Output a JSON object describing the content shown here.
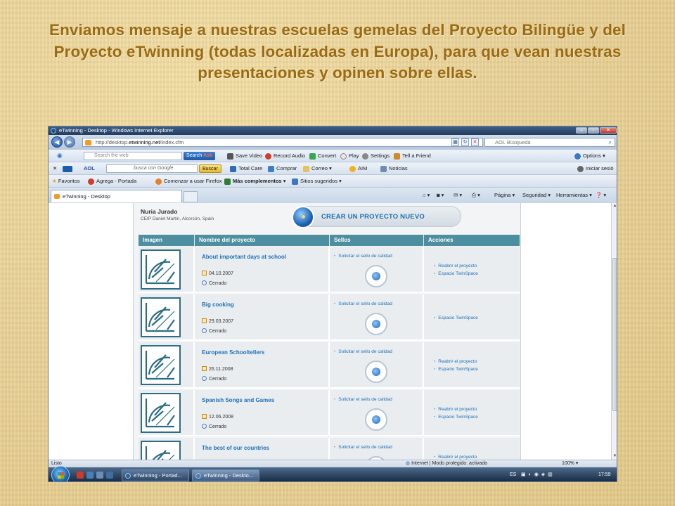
{
  "slide": {
    "title": "Enviamos mensaje a nuestras escuelas gemelas del Proyecto Bilingüe y del Proyecto eTwinning  (todas localizadas en Europa), para que vean nuestras presentaciones y opinen sobre ellas."
  },
  "browser": {
    "window_title": "eTwinning - Desktop - Windows Internet Explorer",
    "address_prefix": "http://desktop.",
    "address_domain": "etwinning.net",
    "address_suffix": "/index.cfm",
    "search_placeholder": "AOL Búsqueda",
    "ask_toolbar": {
      "search_placeholder": "Search the web",
      "search_button": "Search",
      "items": [
        "Save Video",
        "Record Audio",
        "Convert",
        "Play",
        "Settings",
        "Tell a Friend"
      ],
      "options": "Options"
    },
    "aol_toolbar": {
      "aol_label": "AOL",
      "google_placeholder": "busca con Google",
      "buscar_button": "Buscar",
      "items": [
        "Total Care",
        "Comprar",
        "Correo",
        "AIM",
        "Noticias"
      ],
      "login": "Iniciar sesió"
    },
    "favorites_bar": {
      "favorites": "Favoritos",
      "items": [
        "Agrega - Portada",
        "Comenzar a usar Firefox",
        "Más complementos",
        "Sitios sugeridos"
      ]
    },
    "tab_label": "eTwinning - Desktop",
    "command_bar": [
      "Página",
      "Seguridad",
      "Herramientas"
    ],
    "status_left": "Listo",
    "status_zone": "Internet | Modo protegido: activado",
    "zoom": "100%"
  },
  "page": {
    "user_name": "Nuria Jurado",
    "user_school": "CEIP Daniel Martín, Alcorcón, Spain",
    "create_button": "CREAR UN PROYECTO NUEVO",
    "table_headers": [
      "Imagen",
      "Nombre del proyecto",
      "Sellos",
      "Acciones"
    ],
    "projects": [
      {
        "name": "About important days at school",
        "date": "04.10.2007",
        "status": "Cerrado",
        "sello": "Solicitar el sello de calidad",
        "actions": [
          "Reabrir el proyecto",
          "Espacio TwinSpace"
        ]
      },
      {
        "name": "Big cooking",
        "date": "29.03.2007",
        "status": "Cerrado",
        "sello": "Solicitar el sello de calidad",
        "actions": [
          "Espacio TwinSpace"
        ]
      },
      {
        "name": "European Schooltellers",
        "date": "26.11.2008",
        "status": "Cerrado",
        "sello": "Solicitar el sello de calidad",
        "actions": [
          "Reabrir el proyecto",
          "Espacio TwinSpace"
        ]
      },
      {
        "name": "Spanish Songs and Games",
        "date": "12.06.2008",
        "status": "Cerrado",
        "sello": "Solicitar el sello de calidad",
        "actions": [
          "Reabrir el proyecto",
          "Espacio TwinSpace"
        ]
      },
      {
        "name": "The best of our countries",
        "date": "",
        "status": "",
        "sello": "Solicitar el sello de calidad",
        "actions": [
          "Reabrir el proyecto"
        ]
      }
    ]
  },
  "taskbar": {
    "tasks": [
      "eTwinning - Portad...",
      "eTwinning - Deskto..."
    ],
    "language": "ES",
    "time": "17:59"
  }
}
